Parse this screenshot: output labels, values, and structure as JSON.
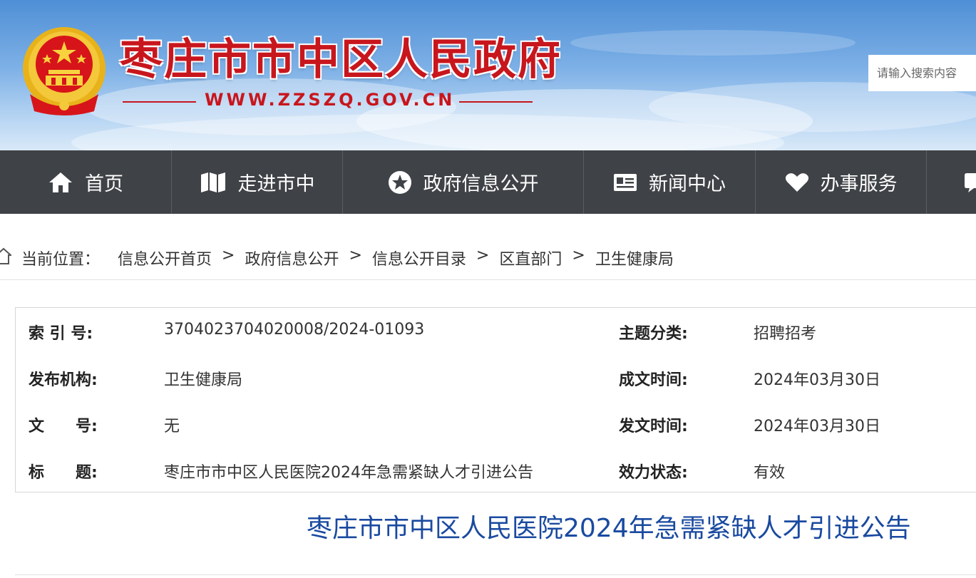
{
  "header": {
    "site_title": "枣庄市市中区人民政府",
    "site_url": "WWW.ZZSZQ.GOV.CN",
    "search_placeholder": "请输入搜索内容"
  },
  "nav": {
    "items": [
      {
        "label": "首页",
        "icon": "home-icon"
      },
      {
        "label": "走进市中",
        "icon": "map-icon"
      },
      {
        "label": "政府信息公开",
        "icon": "star-circle-icon"
      },
      {
        "label": "新闻中心",
        "icon": "id-card-icon"
      },
      {
        "label": "办事服务",
        "icon": "heart-icon"
      }
    ]
  },
  "breadcrumb": {
    "label": "当前位置：",
    "items": [
      "信息公开首页",
      "政府信息公开",
      "信息公开目录",
      "区直部门",
      "卫生健康局"
    ],
    "separator": ">"
  },
  "meta": {
    "rows": [
      {
        "k1": "索 引 号:",
        "v1": "3704023704020008/2024-01093",
        "k2": "主题分类:",
        "v2": "招聘招考"
      },
      {
        "k1": "发布机构:",
        "v1": "卫生健康局",
        "k2": "成文时间:",
        "v2": "2024年03月30日"
      },
      {
        "k1": "文　　号:",
        "v1": "无",
        "k2": "发文时间:",
        "v2": "2024年03月30日"
      },
      {
        "k1": "标　　题:",
        "v1": "枣庄市市中区人民医院2024年急需紧缺人才引进公告",
        "k2": "效力状态:",
        "v2": "有效"
      }
    ]
  },
  "article": {
    "title": "枣庄市市中区人民医院2024年急需紧缺人才引进公告"
  },
  "colors": {
    "title_red": "#c8161d",
    "nav_bg": "#3f4246",
    "article_title_blue": "#1a4aa0"
  }
}
